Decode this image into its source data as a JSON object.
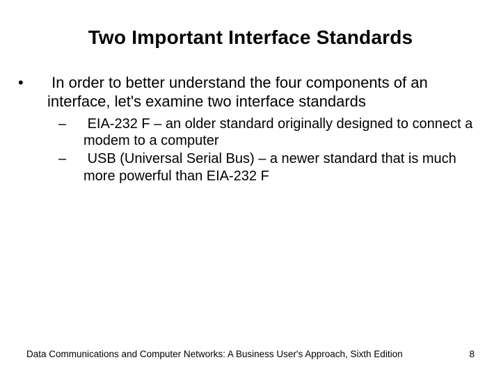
{
  "title": "Two Important Interface Standards",
  "bullets": {
    "main": "In order to better understand the four components of an interface, let's examine two interface standards",
    "sub1": "EIA-232 F – an older standard originally designed to connect a modem to a computer",
    "sub2": "USB (Universal Serial Bus) – a newer standard that is much more powerful than EIA-232 F"
  },
  "footer": {
    "text": "Data Communications and Computer Networks: A Business User's Approach, Sixth Edition",
    "page": "8"
  }
}
